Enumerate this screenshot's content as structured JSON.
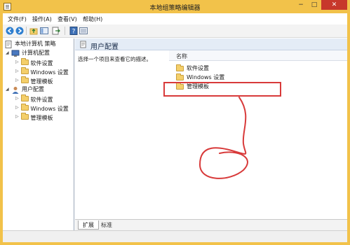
{
  "window": {
    "title": "本地组策略编辑器",
    "minimize_glyph": "−",
    "maximize_glyph": "□",
    "close_glyph": "✕",
    "accent_color": "#f2c24a",
    "close_color": "#c7382b"
  },
  "menu": {
    "items": [
      {
        "label": "文件(F)"
      },
      {
        "label": "操作(A)"
      },
      {
        "label": "查看(V)"
      },
      {
        "label": "帮助(H)"
      }
    ]
  },
  "toolbar": {
    "icons": [
      "back-arrow-icon",
      "forward-arrow-icon",
      "up-folder-icon",
      "show-hide-tree-icon",
      "export-list-icon",
      "help-icon",
      "filter-icon"
    ]
  },
  "tree": {
    "root": {
      "label": "本地计算机 策略",
      "icon": "policy-document-icon"
    },
    "computer": {
      "label": "计算机配置",
      "icon": "computer-icon",
      "children": [
        {
          "label": "软件设置"
        },
        {
          "label": "Windows 设置"
        },
        {
          "label": "管理模板"
        }
      ]
    },
    "user": {
      "label": "用户配置",
      "icon": "user-icon",
      "children": [
        {
          "label": "软件设置"
        },
        {
          "label": "Windows 设置"
        },
        {
          "label": "管理模板"
        }
      ]
    }
  },
  "details": {
    "header_title": "用户配置",
    "description": "选择一个项目来查看它的描述。",
    "column_name": "名称",
    "items": [
      {
        "label": "软件设置"
      },
      {
        "label": "Windows 设置"
      },
      {
        "label": "管理模板"
      }
    ],
    "highlighted_item": "管理模板",
    "annotation_color": "#d83a3a"
  },
  "tabs": [
    {
      "label": "扩展"
    },
    {
      "label": "标准"
    }
  ]
}
